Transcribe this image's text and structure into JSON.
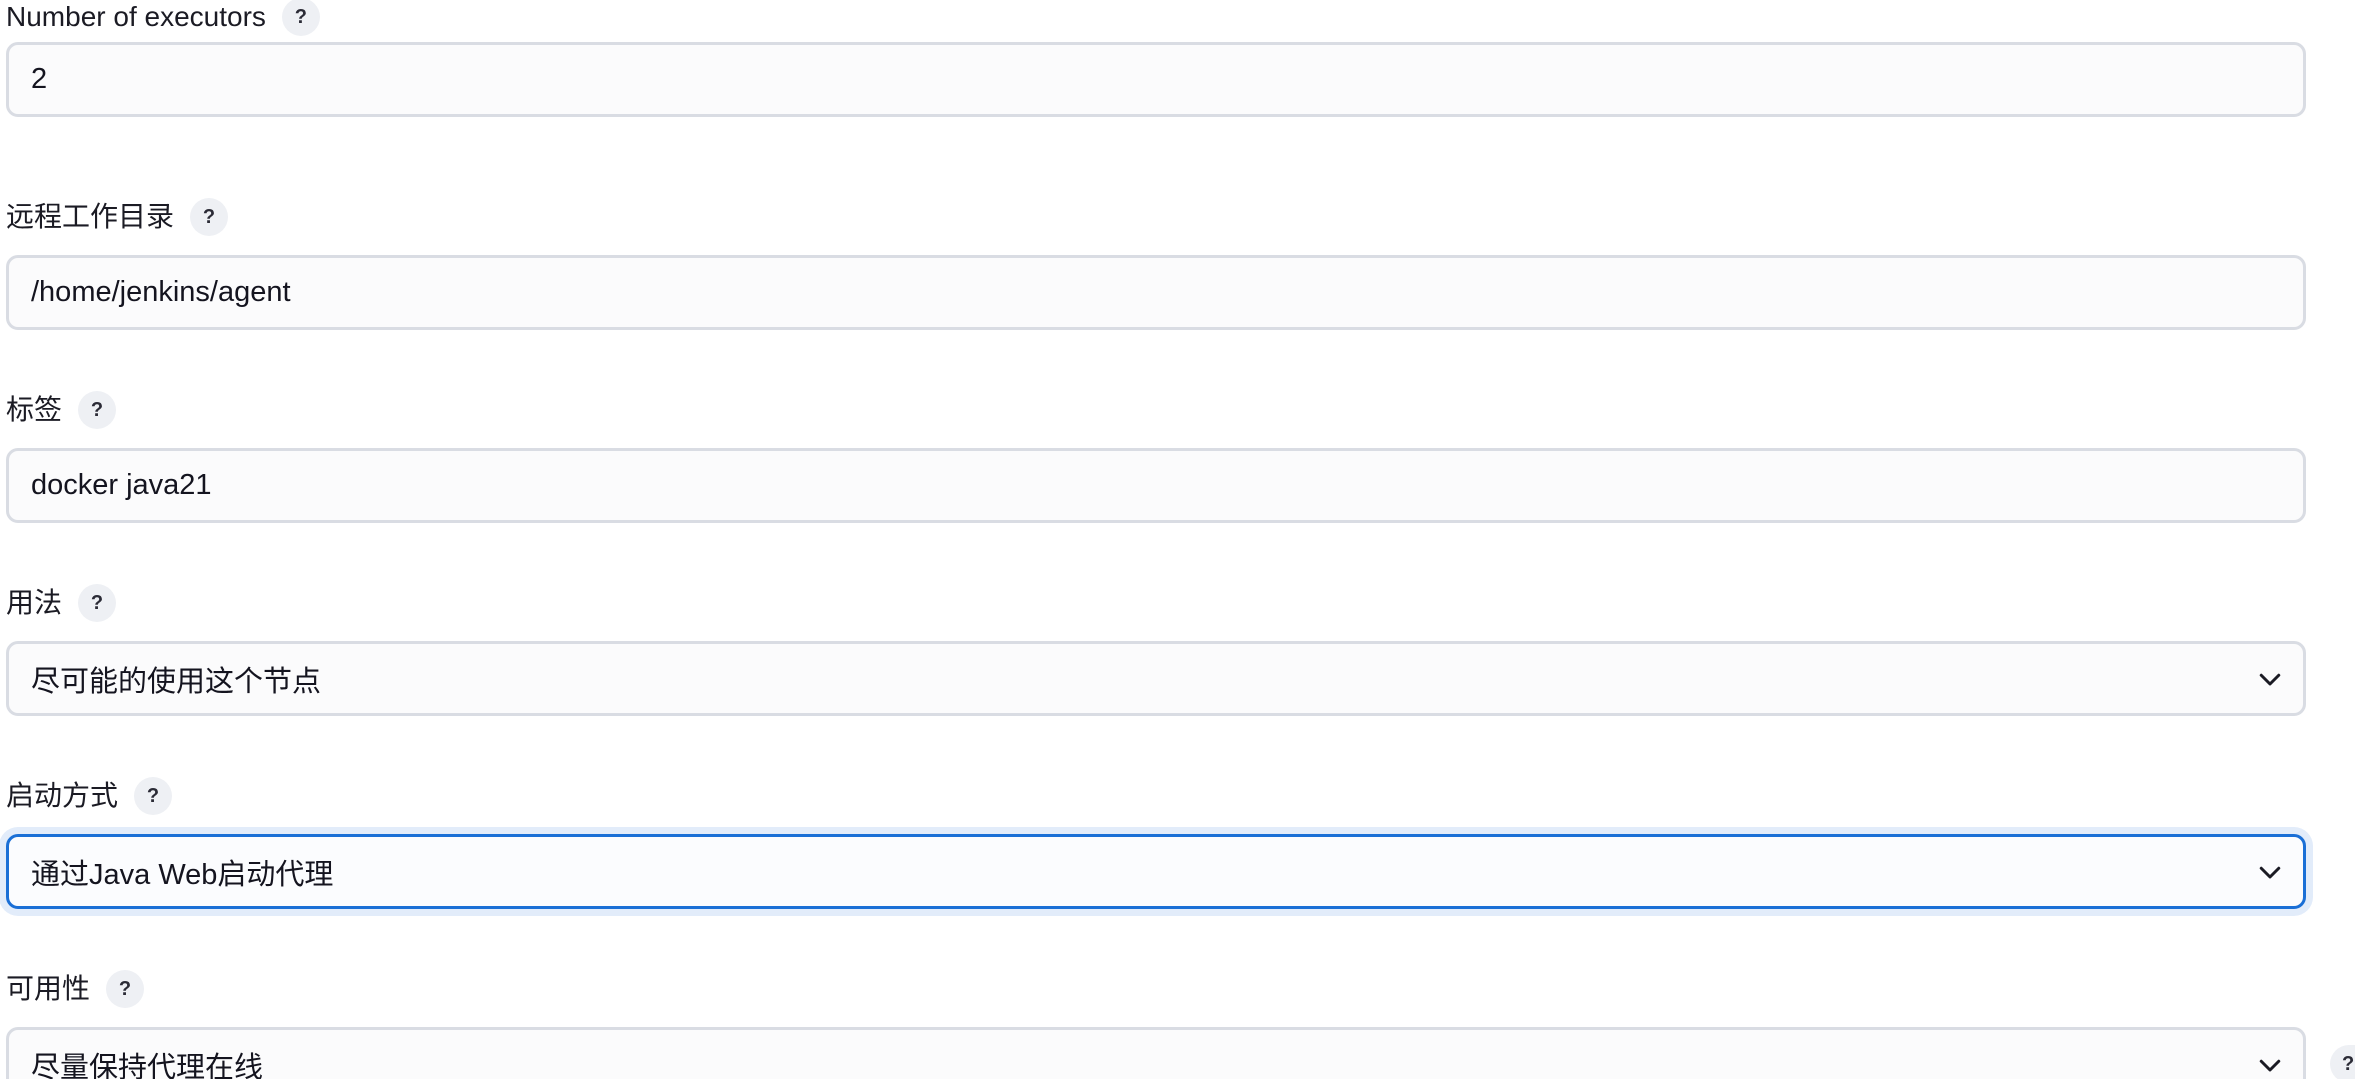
{
  "fields": {
    "executors": {
      "label": "Number of executors",
      "help": "?",
      "value": "2"
    },
    "remote_dir": {
      "label": "远程工作目录",
      "help": "?",
      "value": "/home/jenkins/agent"
    },
    "labels": {
      "label": "标签",
      "help": "?",
      "value": "docker java21"
    },
    "usage": {
      "label": "用法",
      "help": "?",
      "selected": "尽可能的使用这个节点",
      "icon": "chevron-down-icon"
    },
    "launch_method": {
      "label": "启动方式",
      "help": "?",
      "selected": "通过Java Web启动代理",
      "icon": "chevron-down-icon"
    },
    "availability": {
      "label": "可用性",
      "help": "?",
      "selected": "尽量保持代理在线",
      "icon": "chevron-down-icon",
      "side_help": "?"
    }
  },
  "colors": {
    "focus_border": "#1a6fd6",
    "field_border": "#d9dce3",
    "help_bg": "#eef0f4"
  }
}
